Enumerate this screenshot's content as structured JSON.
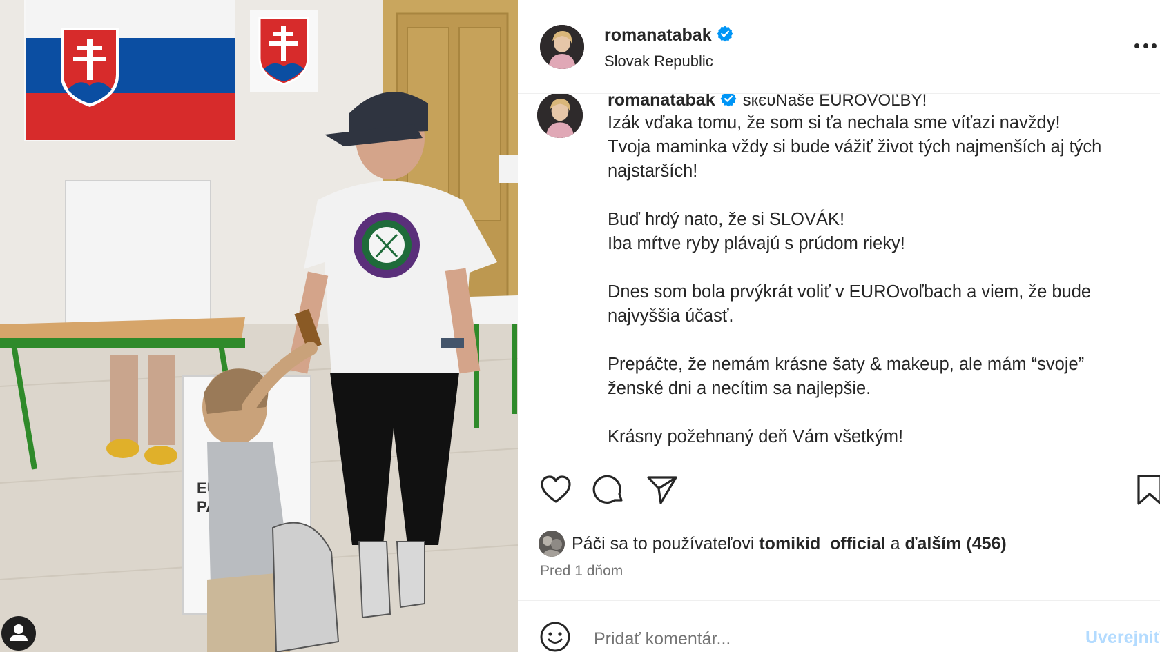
{
  "post": {
    "username": "romanatabak",
    "location": "Slovak Republic",
    "verified_icon": "verified-badge-icon",
    "more_icon": "more-horizontal-icon"
  },
  "photo": {
    "ballot_box_text_1": "EU",
    "ballot_box_text_2": "PAI"
  },
  "caption": {
    "username": "romanatabak",
    "first_line": "sкєᴜNaše EUROVOĽBY!",
    "lines": [
      "Izák vďaka tomu, že som si ťa nechala sme víťazi navždy!",
      "Tvoja maminka vždy si bude vážiť život tých najmenších aj tých",
      "najstarších!",
      "Buď hrdý nato, že si SLOVÁK!",
      "Iba mŕtve ryby plávajú s prúdom rieky!",
      "Dnes som bola prvýkrát voliť v EUROvoľbach a viem, že bude",
      "najvyššia účasť.",
      "Prepáčte, že nemám krásne šaty & makeup, ale mám “svoje”",
      "ženské dni a necítim sa najlepšie.",
      "Krásny požehnaný deň Vám všetkým!"
    ]
  },
  "actions": {
    "like_icon": "heart-icon",
    "comment_icon": "comment-icon",
    "share_icon": "send-icon",
    "save_icon": "bookmark-icon"
  },
  "likes": {
    "prefix": "Páči sa to používateľovi",
    "user": "tomikid_official",
    "joiner": "a",
    "others": "ďalším (456)"
  },
  "timestamp": "Pred 1 dňom",
  "comment": {
    "placeholder": "Pridať komentár...",
    "post_label": "Uverejniť",
    "emoji_icon": "emoji-icon"
  },
  "colors": {
    "verified_blue": "#0095f6",
    "post_button_disabled": "#b3dbff",
    "text": "#262626",
    "secondary_text": "#737373"
  }
}
